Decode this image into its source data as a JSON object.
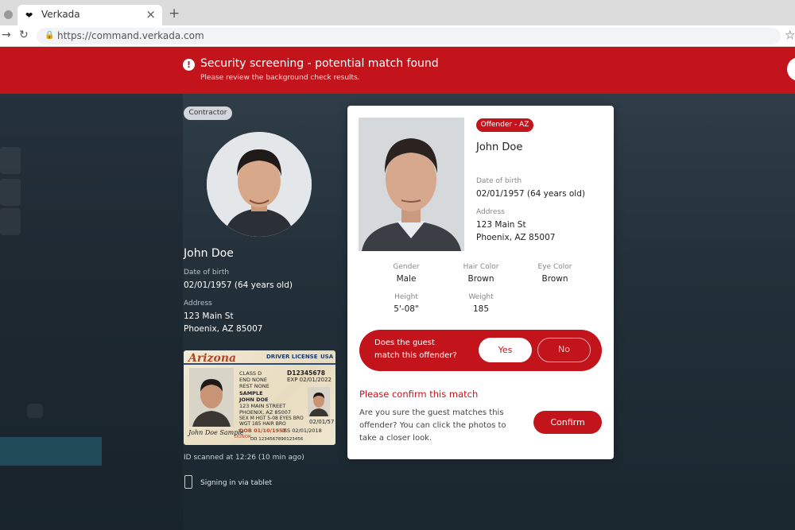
{
  "browser": {
    "tab_title": "Verkada",
    "url": "https://command.verkada.com"
  },
  "banner": {
    "title": "Security screening - potential match found",
    "subtitle": "Please review the background check results."
  },
  "guest": {
    "badge": "Contractor",
    "name": "John Doe",
    "dob_label": "Date of birth",
    "dob": "02/01/1957 (64 years old)",
    "address_label": "Address",
    "address_line1": "123 Main St",
    "address_line2": "Phoenix, AZ 85007",
    "scanned": "ID scanned at 12:26 (10 min ago)",
    "signin": "Signing in via tablet"
  },
  "license": {
    "state": "Arizona",
    "type": "DRIVER LICENSE",
    "country": "USA",
    "class": "CLASS D",
    "dl_no": "D12345678",
    "end": "END NONE",
    "rest": "REST NONE",
    "exp": "EXP 02/01/2022",
    "name_last": "SAMPLE",
    "name_first": "JOHN DOE",
    "street": "123 MAIN STREET",
    "city": "PHOENIX, AZ 85007",
    "dob": "DOB 01/10/1957",
    "details": "SEX M HGT 5-08 EYES BRO",
    "details2": "WGT 185 HAIR BRO",
    "iss": "ISS 02/01/2018",
    "small_date": "02/01/57",
    "doc_no": "DD 1234567890123456",
    "signature": "John Doe Sample",
    "donor": "DONOR"
  },
  "offender": {
    "badge": "Offender - AZ",
    "name": "John Doe",
    "dob_label": "Date of birth",
    "dob": "02/01/1957  (64 years old)",
    "address_label": "Address",
    "address_line1": "123 Main St",
    "address_line2": "Phoenix, AZ 85007",
    "attrs": [
      {
        "label": "Gender",
        "value": "Male"
      },
      {
        "label": "Hair Color",
        "value": "Brown"
      },
      {
        "label": "Eye Color",
        "value": "Brown"
      },
      {
        "label": "Height",
        "value": "5'-08\""
      },
      {
        "label": "Weight",
        "value": "185"
      }
    ]
  },
  "match": {
    "question_line1": "Does the guest",
    "question_line2": "match this offender?",
    "yes": "Yes",
    "no": "No"
  },
  "confirm": {
    "title": "Please confirm this match",
    "text": "Are you sure the guest matches this offender? You can click the photos to take a closer look.",
    "button": "Confirm"
  },
  "colors": {
    "accent": "#c3141c",
    "background": "#1d2a33"
  }
}
